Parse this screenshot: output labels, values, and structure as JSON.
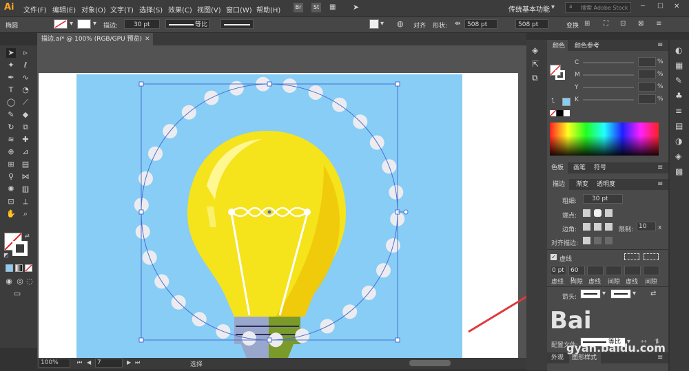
{
  "app": {
    "logo": "Ai"
  },
  "menu": [
    "文件(F)",
    "编辑(E)",
    "对象(O)",
    "文字(T)",
    "选择(S)",
    "效果(C)",
    "视图(V)",
    "窗口(W)",
    "帮助(H)"
  ],
  "bridge_btn": "Br",
  "stock_btn": "St",
  "workspace": "传统基本功能",
  "search_placeholder": "搜索 Adobe Stock",
  "control": {
    "object_type": "椭圆",
    "stroke_label": "描边:",
    "stroke_value": "30 pt",
    "profile_label": "等比",
    "align_label": "对齐",
    "shape_label": "形状:",
    "width_value": "508 pt",
    "height_value": "508 pt",
    "transform_label": "变换",
    "ime_text": "中"
  },
  "document_tab": "描边.ai* @ 100% (RGB/GPU 预览)",
  "status": {
    "zoom": "100%",
    "page": "7",
    "mode": "选择"
  },
  "color_panel": {
    "tabs": [
      "颜色",
      "颜色参考"
    ],
    "channels": [
      "C",
      "M",
      "Y",
      "K"
    ],
    "unit": "%"
  },
  "swatch_tabs": [
    "色板",
    "画笔",
    "符号"
  ],
  "stroke_panel": {
    "tabs": [
      "描边",
      "渐变",
      "透明度"
    ],
    "weight_label": "粗细:",
    "weight_value": "30 pt",
    "cap_label": "端点:",
    "corner_label": "边角:",
    "limit_label": "限制:",
    "limit_value": "10",
    "limit_unit": "x",
    "align_label": "对齐描边:",
    "dashed_label": "虚线",
    "dash_values": [
      "0 pt",
      "60 p",
      "",
      "",
      "",
      ""
    ],
    "dash_labels": [
      "虚线",
      "间隙",
      "虚线",
      "间隙",
      "虚线",
      "间隙"
    ],
    "arrow_label": "箭头:",
    "profile_label": "配置文件:",
    "profile_value": "等比"
  },
  "bottom_tabs": [
    "外观",
    "图形样式"
  ],
  "watermark": {
    "text1": "Bai",
    "text2": "gyan.baidu.com"
  },
  "colors": {
    "accent": "#87cdf5",
    "bulb": "#f5e31c",
    "arrow": "#e03a3a"
  }
}
